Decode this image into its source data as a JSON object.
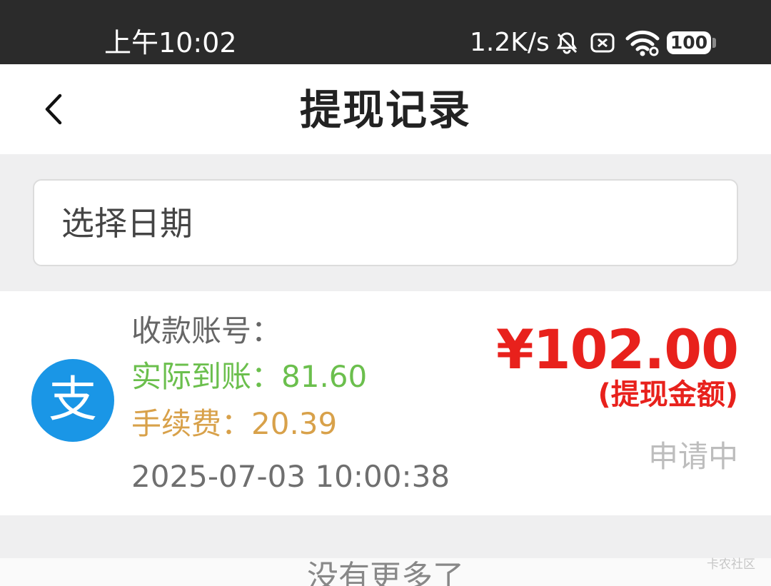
{
  "status_bar": {
    "time": "上午10:02",
    "network_speed": "1.2K/s",
    "battery": "100",
    "icons": [
      "mute-icon",
      "x-box-icon",
      "wifi-icon",
      "battery-icon"
    ]
  },
  "header": {
    "back_icon": "chevron-left-icon",
    "title": "提现记录"
  },
  "filter": {
    "date_placeholder": "选择日期"
  },
  "record": {
    "icon": "alipay-icon",
    "logo_glyph": "支",
    "account_label": "收款账号：",
    "account_value": "",
    "actual_label": "实际到账：",
    "actual_value": "81.60",
    "fee_label": "手续费：",
    "fee_value": "20.39",
    "timestamp": "2025-07-03 10:00:38",
    "amount": "¥102.00",
    "amount_label": "(提现金额)",
    "status": "申请中"
  },
  "footer": {
    "no_more": "没有更多了",
    "watermark": "卡农社区"
  },
  "colors": {
    "amount": "#e8211c",
    "actual": "#6bbf4d",
    "fee": "#d8a14a",
    "alipay_blue": "#1a96e6",
    "status_bar": "#2b2b2b"
  }
}
